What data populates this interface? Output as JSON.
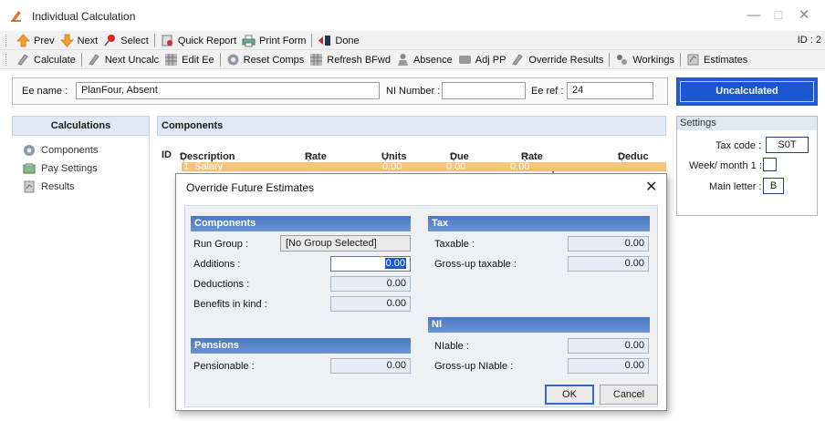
{
  "window": {
    "title": "Individual Calculation",
    "minimize": "—",
    "maximize": "☐",
    "close": "✕"
  },
  "toolbar1": {
    "prev": "Prev",
    "next": "Next",
    "select": "Select",
    "quick_report": "Quick Report",
    "print_form": "Print Form",
    "done": "Done",
    "id_label": "ID : 2"
  },
  "toolbar2": {
    "calculate": "Calculate",
    "next_uncalc": "Next Uncalc",
    "edit_ee": "Edit Ee",
    "reset_comps": "Reset Comps",
    "refresh_bfwd": "Refresh BFwd",
    "absence": "Absence",
    "adj_pp": "Adj PP",
    "override_results": "Override Results",
    "workings": "Workings",
    "estimates": "Estimates"
  },
  "employee": {
    "name_label": "Ee name :",
    "name_value": "PlanFour, Absent",
    "ni_label": "NI Number :",
    "ni_value": "",
    "ref_label": "Ee ref :",
    "ref_value": "24",
    "status": "Uncalculated"
  },
  "calculations": {
    "header": "Calculations",
    "items": [
      {
        "label": "Components",
        "icon": "components-icon"
      },
      {
        "label": "Pay Settings",
        "icon": "pay-settings-icon"
      },
      {
        "label": "Results",
        "icon": "results-icon"
      }
    ]
  },
  "components": {
    "header": "Components",
    "columns": [
      "ID",
      "Description",
      "Rate",
      "Units",
      "Due",
      "Rate Description",
      "Deduc"
    ],
    "row": {
      "id": "1",
      "description": "Salary",
      "rate": "0.00",
      "units": "0.00",
      "due": "0.00"
    }
  },
  "settings": {
    "header": "Settings",
    "tax_code_label": "Tax code :",
    "tax_code": "S0T",
    "week1_label": "Week/ month 1 :",
    "main_letter_label": "Main letter :",
    "main_letter": "B"
  },
  "dialog": {
    "title": "Override Future Estimates",
    "close": "✕",
    "components": {
      "header": "Components",
      "run_group_label": "Run Group :",
      "run_group_value": "[No Group Selected]",
      "additions_label": "Additions :",
      "additions_value": "0.00",
      "deductions_label": "Deductions :",
      "deductions_value": "0.00",
      "bik_label": "Benefits in kind  :",
      "bik_value": "0.00"
    },
    "pensions": {
      "header": "Pensions",
      "pensionable_label": "Pensionable :",
      "pensionable_value": "0.00"
    },
    "tax": {
      "header": "Tax",
      "taxable_label": "Taxable :",
      "taxable_value": "0.00",
      "grossup_label": "Gross-up taxable :",
      "grossup_value": "0.00"
    },
    "ni": {
      "header": "NI",
      "niable_label": "NIable :",
      "niable_value": "0.00",
      "grossup_label": "Gross-up NIable :",
      "grossup_value": "0.00"
    },
    "ok": "OK",
    "cancel": "Cancel"
  }
}
